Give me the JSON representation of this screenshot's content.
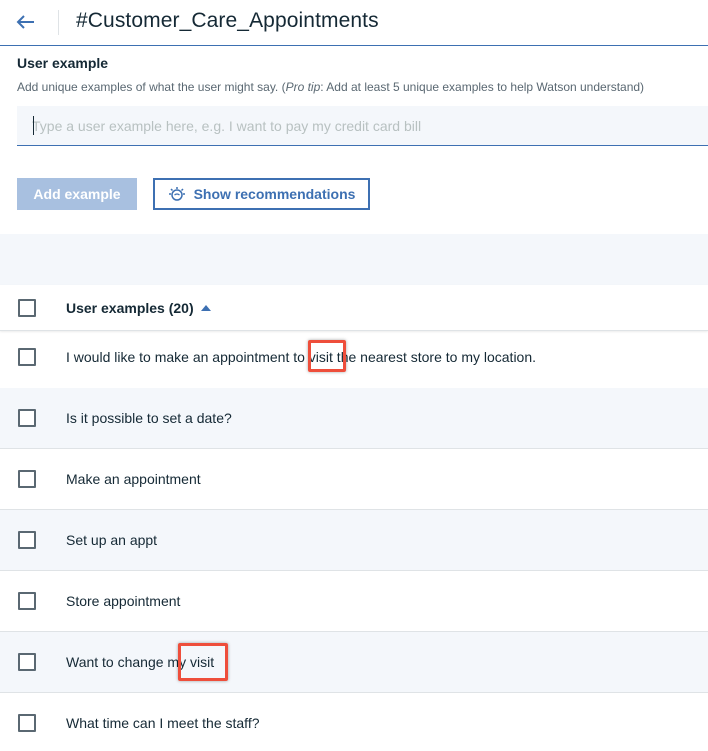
{
  "header": {
    "back_icon": "arrow-left-icon",
    "title": "#Customer_Care_Appointments"
  },
  "user_example": {
    "title": "User example",
    "desc_prefix": "Add unique examples of what the user might say. (",
    "desc_protip": "Pro tip",
    "desc_suffix": ": Add at least 5 unique examples to help Watson understand)",
    "placeholder": "Type a user example here, e.g. I want to pay my credit card bill",
    "value": "",
    "add_button": "Add example",
    "recommend_button": "Show recommendations",
    "recommend_icon": "watson-bulb-icon"
  },
  "table": {
    "header_label": "User examples (20)",
    "sort_icon": "caret-up-icon",
    "rows": [
      {
        "text": "I would like to make an appointment to visit the nearest store to my location.",
        "highlight": "visit"
      },
      {
        "text": "Is it possible to set a date?"
      },
      {
        "text": "Make an appointment"
      },
      {
        "text": "Set up an appt"
      },
      {
        "text": "Store appointment"
      },
      {
        "text": "Want to change my visit",
        "highlight": "visit"
      },
      {
        "text": "What time can I meet the staff?"
      }
    ]
  },
  "colors": {
    "accent": "#3d70b2",
    "highlight_border": "#ee4e3b",
    "disabled_button": "#a8c0e0",
    "row_alt": "#f4f7fb"
  }
}
